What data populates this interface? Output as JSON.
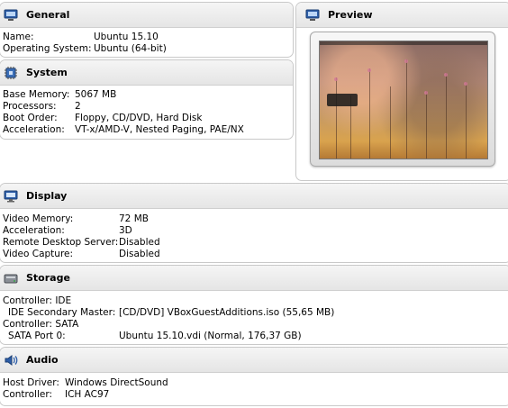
{
  "general": {
    "title": "General",
    "rows": [
      {
        "label": "Name:",
        "value": "Ubuntu 15.10"
      },
      {
        "label": "Operating System:",
        "value": "Ubuntu (64-bit)"
      }
    ]
  },
  "preview": {
    "title": "Preview"
  },
  "system": {
    "title": "System",
    "rows": [
      {
        "label": "Base Memory:",
        "value": "5067 MB"
      },
      {
        "label": "Processors:",
        "value": "2"
      },
      {
        "label": "Boot Order:",
        "value": "Floppy, CD/DVD, Hard Disk"
      },
      {
        "label": "Acceleration:",
        "value": "VT-x/AMD-V, Nested Paging, PAE/NX"
      }
    ]
  },
  "display": {
    "title": "Display",
    "rows": [
      {
        "label": "Video Memory:",
        "value": "72 MB"
      },
      {
        "label": "Acceleration:",
        "value": "3D"
      },
      {
        "label": "Remote Desktop Server:",
        "value": "Disabled"
      },
      {
        "label": "Video Capture:",
        "value": "Disabled"
      }
    ]
  },
  "storage": {
    "title": "Storage",
    "rows": [
      {
        "label": "Controller: IDE",
        "value": ""
      },
      {
        "label": " IDE Secondary Master:",
        "value": "[CD/DVD] VBoxGuestAdditions.iso (55,65 MB)"
      },
      {
        "label": "Controller: SATA",
        "value": ""
      },
      {
        "label": " SATA Port 0:",
        "value": "Ubuntu 15.10.vdi (Normal, 176,37 GB)"
      }
    ]
  },
  "audio": {
    "title": "Audio",
    "rows": [
      {
        "label": "Host Driver:",
        "value": "Windows DirectSound"
      },
      {
        "label": "Controller:",
        "value": "ICH AC97"
      }
    ]
  }
}
